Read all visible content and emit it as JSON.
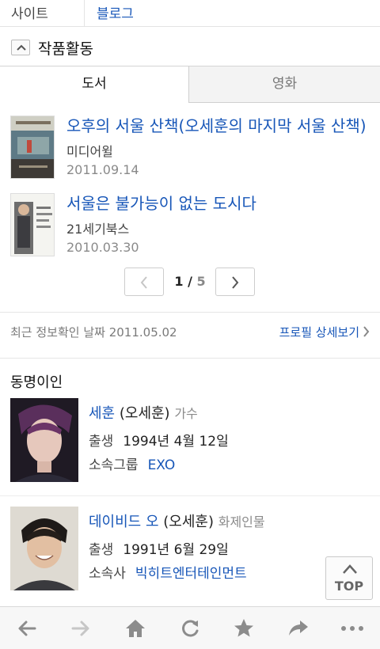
{
  "site": {
    "label": "사이트",
    "value": "블로그"
  },
  "works": {
    "title": "작품활동"
  },
  "tabs": [
    {
      "label": "도서"
    },
    {
      "label": "영화"
    }
  ],
  "books": [
    {
      "title": "오후의 서울 산책(오세훈의 마지막 서울 산책)",
      "publisher": "미디어윌",
      "date": "2011.09.14"
    },
    {
      "title": "서울은 불가능이 없는 도시다",
      "publisher": "21세기북스",
      "date": "2010.03.30"
    }
  ],
  "pager": {
    "current": "1",
    "slash": " / ",
    "total": "5"
  },
  "info": {
    "text": "최근 정보확인 날짜 2011.05.02",
    "profile_link": "프로필 상세보기"
  },
  "namesake": {
    "title": "동명이인",
    "people": [
      {
        "name": "세훈",
        "real": "(오세훈)",
        "role": "가수",
        "k1": "출생",
        "v1": "1994년 4월 12일",
        "k2": "소속그룹",
        "v2": "EXO"
      },
      {
        "name": "데이비드 오",
        "real": "(오세훈)",
        "role": "화제인물",
        "k1": "출생",
        "v1": "1991년 6월 29일",
        "k2": "소속사",
        "v2": "빅히트엔터테인먼트"
      }
    ]
  },
  "top_button": {
    "label": "TOP"
  },
  "toolbar": [
    "back-icon",
    "forward-icon",
    "home-icon",
    "reload-icon",
    "star-icon",
    "share-icon",
    "more-icon"
  ],
  "colors": {
    "link": "#1756b8",
    "gray_text": "#8a8a8a",
    "toolbar_icon": "#8c8c8c",
    "toolbar_icon_disabled": "#c6c6c6"
  }
}
